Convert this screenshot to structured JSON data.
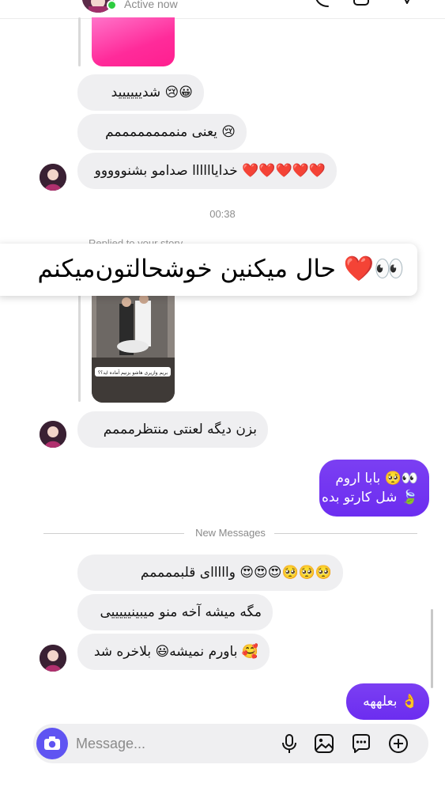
{
  "header": {
    "status": "Active now"
  },
  "messages": {
    "m1": "😀😢 شدیییییید",
    "m2": "😢 یعنی منممممممممم",
    "m3": "❤️❤️❤️❤️❤️ خدایاااااا صدامو بشنووووو",
    "time": "00:38",
    "replied_label": "Replied to your story",
    "banner": "👀❤️ حال میکنین خوشحالتون‌میکنم",
    "story_caption": "بریم وازیری هاشو بزنیم آماده اید؟؟",
    "m4": "بزن دیگه لعنتی منتظرمممم",
    "sent1_line1": "👀🥺 بابا اروم",
    "sent1_line2": "🍃 شل کارتو بده",
    "new_messages": "New Messages",
    "m5": "🥺🥺🥺😍😍😍 وااااای قلبممممم",
    "m6": "مگه میشه آخه منو میبینیییییی",
    "m7": "🥰 باورم نمیشه😃 بلاخره شد",
    "sent2": "👌 بعلههه"
  },
  "composer": {
    "placeholder": "Message..."
  },
  "colors": {
    "accent": "#6c2df0",
    "bubble": "#efeff1",
    "online": "#2ecc40",
    "camera": "#5f54f2"
  },
  "icons": [
    "back-icon",
    "phone-icon",
    "video-icon",
    "flag-icon",
    "camera-icon",
    "microphone-icon",
    "image-icon",
    "sticker-icon",
    "plus-icon"
  ]
}
